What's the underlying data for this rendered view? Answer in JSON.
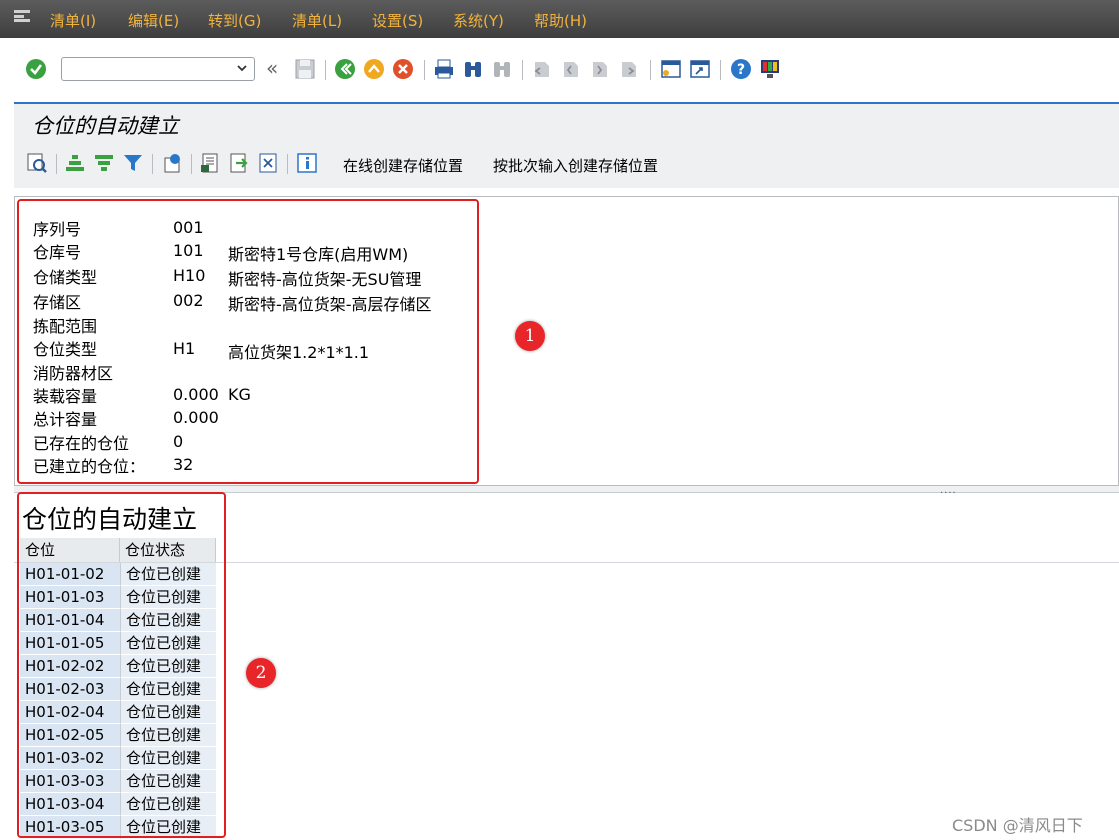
{
  "menu": {
    "items": [
      "清单(I)",
      "编辑(E)",
      "转到(G)",
      "清单(L)",
      "设置(S)",
      "系统(Y)",
      "帮助(H)"
    ]
  },
  "toolbar": {
    "command_value": "",
    "nav_back_glyph": "«"
  },
  "page": {
    "title": "仓位的自动建立"
  },
  "app_toolbar": {
    "online_create_label": "在线创建存储位置",
    "batch_create_label": "按批次输入创建存储位置"
  },
  "header_fields": [
    {
      "label": "序列号",
      "value": "001",
      "desc": ""
    },
    {
      "label": "仓库号",
      "value": "101",
      "desc": "斯密特1号仓库(启用WM)"
    },
    {
      "label": "仓储类型",
      "value": "H10",
      "desc": "斯密特-高位货架-无SU管理"
    },
    {
      "label": "存储区",
      "value": "002",
      "desc": "斯密特-高位货架-高层存储区"
    },
    {
      "label": "拣配范围",
      "value": "",
      "desc": ""
    },
    {
      "label": "仓位类型",
      "value": "H1",
      "desc": "高位货架1.2*1*1.1"
    },
    {
      "label": "消防器材区",
      "value": "",
      "desc": ""
    },
    {
      "label": "装载容量",
      "value": "0.000",
      "desc": "KG"
    },
    {
      "label": "总计容量",
      "value": "0.000",
      "desc": ""
    },
    {
      "label": "已存在的仓位",
      "value": "0",
      "desc": ""
    },
    {
      "label": "已建立的仓位：",
      "value": "32",
      "desc": ""
    }
  ],
  "list": {
    "title": "仓位的自动建立",
    "columns": [
      "仓位",
      "仓位状态"
    ],
    "rows": [
      {
        "bin": "H01-01-02",
        "status": "仓位已创建"
      },
      {
        "bin": "H01-01-03",
        "status": "仓位已创建"
      },
      {
        "bin": "H01-01-04",
        "status": "仓位已创建"
      },
      {
        "bin": "H01-01-05",
        "status": "仓位已创建"
      },
      {
        "bin": "H01-02-02",
        "status": "仓位已创建"
      },
      {
        "bin": "H01-02-03",
        "status": "仓位已创建"
      },
      {
        "bin": "H01-02-04",
        "status": "仓位已创建"
      },
      {
        "bin": "H01-02-05",
        "status": "仓位已创建"
      },
      {
        "bin": "H01-03-02",
        "status": "仓位已创建"
      },
      {
        "bin": "H01-03-03",
        "status": "仓位已创建"
      },
      {
        "bin": "H01-03-04",
        "status": "仓位已创建"
      },
      {
        "bin": "H01-03-05",
        "status": "仓位已创建"
      }
    ]
  },
  "annotations": {
    "badge1": "1",
    "badge2": "2"
  },
  "watermark": "CSDN @清风日下",
  "colors": {
    "menu_text": "#f2b33c",
    "title_accent": "#2a77c9",
    "annotation_red": "#e02020",
    "row_key_bg": "#d9e5f2"
  }
}
